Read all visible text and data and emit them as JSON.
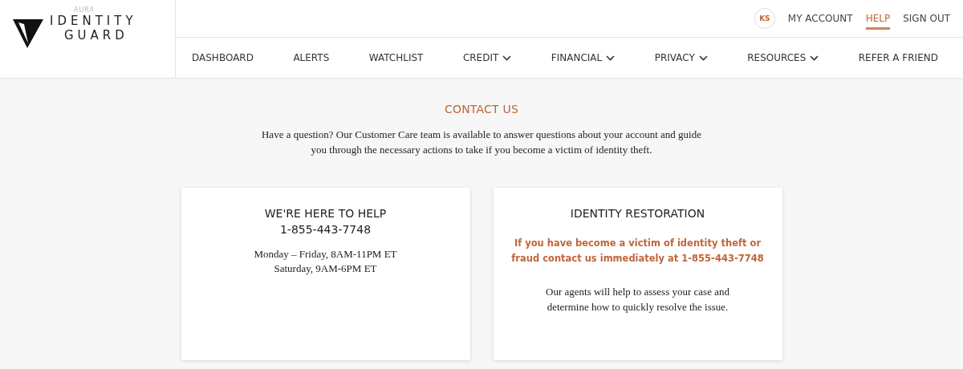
{
  "logo": {
    "brand": "AURA",
    "line_1": "IDENTITY",
    "line_2": "GUARD"
  },
  "top_bar": {
    "avatar": "KS",
    "links": [
      {
        "label": "MY ACCOUNT",
        "selected": false
      },
      {
        "label": "HELP",
        "selected": true
      },
      {
        "label": "SIGN OUT",
        "selected": false
      }
    ]
  },
  "nav": [
    {
      "label": "DASHBOARD",
      "has_menu": false
    },
    {
      "label": "ALERTS",
      "has_menu": false
    },
    {
      "label": "WATCHLIST",
      "has_menu": false
    },
    {
      "label": "CREDIT",
      "has_menu": true
    },
    {
      "label": "FINANCIAL",
      "has_menu": true
    },
    {
      "label": "PRIVACY",
      "has_menu": true
    },
    {
      "label": "RESOURCES",
      "has_menu": true
    },
    {
      "label": "REFER A FRIEND",
      "has_menu": false
    }
  ],
  "heading": "CONTACT US",
  "intro": "Have a question? Our Customer Care team is available to answer questions about your account and guide you through the necessary actions to take if you become a victim of identity theft.",
  "cards": [
    {
      "title": "WE'RE HERE TO HELP",
      "phone": "1-855-443-7748",
      "lines": [
        {
          "kind": "hours",
          "text": "Monday – Friday, 8AM-11PM ET"
        },
        {
          "kind": "hours",
          "text": "Saturday, 9AM-6PM ET"
        }
      ]
    },
    {
      "title": "IDENTITY RESTORATION",
      "lines": [
        {
          "kind": "alert",
          "text": "If you have become a victim of identity theft or fraud contact us immediately at 1-855-443-7748"
        },
        {
          "kind": "note",
          "text": "Our agents will help to assess your case and determine how to quickly resolve the issue."
        }
      ]
    }
  ]
}
